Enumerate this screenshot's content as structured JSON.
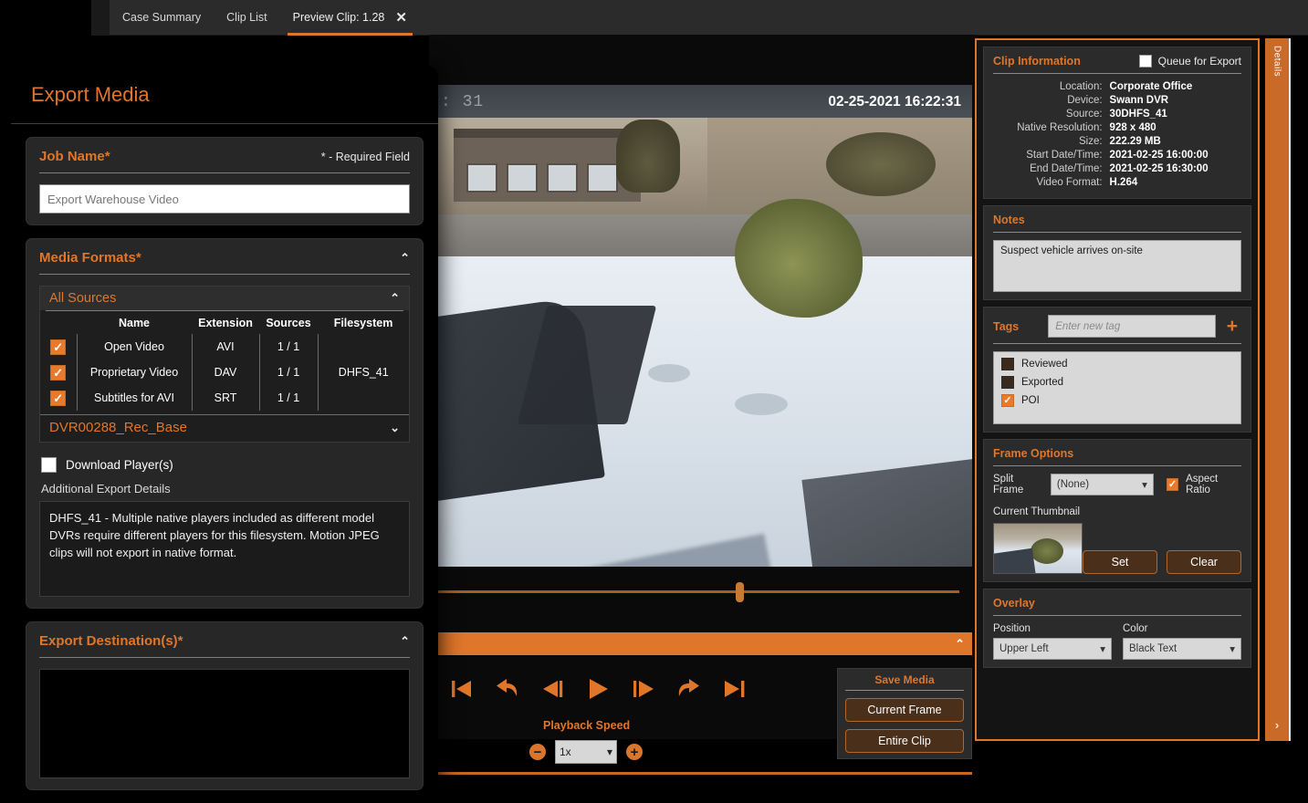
{
  "tabs": [
    {
      "label": "Case Summary",
      "active": false
    },
    {
      "label": "Clip List",
      "active": false
    },
    {
      "label": "Preview Clip: 1.28",
      "active": true
    }
  ],
  "tab_close_glyph": "✕",
  "colors": {
    "accent": "#e0762a",
    "panel_bg": "#272727",
    "app_bg": "#000000",
    "field_bg": "#d8d8d8",
    "checkbox_on": "#ea7a2b"
  },
  "video": {
    "timecode_left": ": 31",
    "timestamp_overlay": "02-25-2021 16:22:31",
    "collapse_glyph": "⌃",
    "transport_buttons": [
      {
        "name": "skip-to-start",
        "glyph": "start"
      },
      {
        "name": "step-back-fast",
        "glyph": "rewind"
      },
      {
        "name": "previous-frame",
        "glyph": "prev-frame"
      },
      {
        "name": "play",
        "glyph": "play"
      },
      {
        "name": "next-frame",
        "glyph": "next-frame"
      },
      {
        "name": "step-forward-fast",
        "glyph": "forward"
      },
      {
        "name": "skip-to-end",
        "glyph": "end"
      }
    ],
    "playback_speed_label": "Playback Speed",
    "playback_speed_value": "1x",
    "speed_minus": "−",
    "speed_plus": "+",
    "save_media": {
      "title": "Save Media",
      "current_frame": "Current Frame",
      "entire_clip": "Entire Clip"
    }
  },
  "export": {
    "title": "Export Media",
    "job_name": {
      "title": "Job Name*",
      "required_note": "* - Required Field",
      "value": "Export Warehouse Video",
      "placeholder": "Export Warehouse Video"
    },
    "media_formats": {
      "title": "Media Formats*",
      "collapse_glyph": "⌃",
      "all_sources_label": "All Sources",
      "columns": [
        "Name",
        "Extension",
        "Sources",
        "Filesystem"
      ],
      "rows": [
        {
          "checked": true,
          "name": "Open Video",
          "extension": "AVI",
          "sources": "1 / 1",
          "filesystem": ""
        },
        {
          "checked": true,
          "name": "Proprietary Video",
          "extension": "DAV",
          "sources": "1 / 1",
          "filesystem": "DHFS_41"
        },
        {
          "checked": true,
          "name": "Subtitles for AVI",
          "extension": "SRT",
          "sources": "1 / 1",
          "filesystem": ""
        }
      ],
      "footer_source": "DVR00288_Rec_Base",
      "footer_glyph": "⌄",
      "download_players_label": "Download Player(s)",
      "download_players_checked": false,
      "additional_details_label": "Additional Export Details",
      "additional_details_text": "DHFS_41 - Multiple native players included as different model DVRs require different players for this filesystem.  Motion JPEG clips will not export in native format."
    },
    "destination": {
      "title": "Export Destination(s)*",
      "collapse_glyph": "⌃"
    }
  },
  "details": {
    "rail_label": "Details",
    "rail_arrow": "›",
    "clip_information": {
      "title": "Clip Information",
      "queue_label": "Queue for Export",
      "queue_checked": false,
      "fields": [
        {
          "key": "Location:",
          "value": "Corporate Office"
        },
        {
          "key": "Device:",
          "value": "Swann DVR"
        },
        {
          "key": "Source:",
          "value": "30DHFS_41"
        },
        {
          "key": "Native Resolution:",
          "value": "928 x 480"
        },
        {
          "key": "Size:",
          "value": "222.29 MB"
        },
        {
          "key": "Start Date/Time:",
          "value": "2021-02-25 16:00:00"
        },
        {
          "key": "End Date/Time:",
          "value": "2021-02-25 16:30:00"
        },
        {
          "key": "Video Format:",
          "value": "H.264"
        }
      ]
    },
    "notes": {
      "title": "Notes",
      "text": "Suspect vehicle arrives on-site"
    },
    "tags": {
      "title": "Tags",
      "input_placeholder": "Enter new tag",
      "add_glyph": "+",
      "items": [
        {
          "label": "Reviewed",
          "checked": false
        },
        {
          "label": "Exported",
          "checked": false
        },
        {
          "label": "POI",
          "checked": true
        }
      ]
    },
    "frame_options": {
      "title": "Frame Options",
      "split_frame_label": "Split Frame",
      "split_frame_value": "(None)",
      "aspect_ratio_label": "Aspect Ratio",
      "aspect_ratio_checked": true,
      "current_thumbnail_label": "Current Thumbnail",
      "set_button": "Set",
      "clear_button": "Clear"
    },
    "overlay": {
      "title": "Overlay",
      "position_label": "Position",
      "position_value": "Upper Left",
      "color_label": "Color",
      "color_value": "Black Text"
    },
    "chevron_down": "⌄"
  }
}
